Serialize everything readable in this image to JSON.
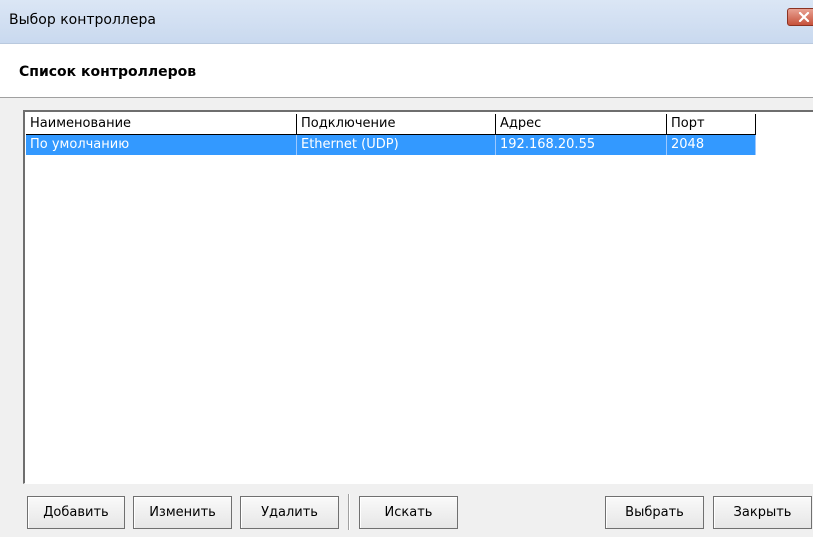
{
  "window": {
    "title": "Выбор контроллера"
  },
  "header": {
    "title": "Список контроллеров"
  },
  "list": {
    "columns": [
      "Наименование",
      "Подключение",
      "Адрес",
      "Порт"
    ],
    "rows": [
      {
        "name": "По умолчанию",
        "connection": "Ethernet (UDP)",
        "address": "192.168.20.55",
        "port": "2048",
        "selected": true
      }
    ]
  },
  "buttons": {
    "add": "Добавить",
    "edit": "Изменить",
    "delete": "Удалить",
    "search": "Искать",
    "select": "Выбрать",
    "close": "Закрыть"
  },
  "colors": {
    "selection": "#3399ff",
    "close_button": "#c7523b"
  },
  "icons": {
    "close": "close-icon"
  }
}
